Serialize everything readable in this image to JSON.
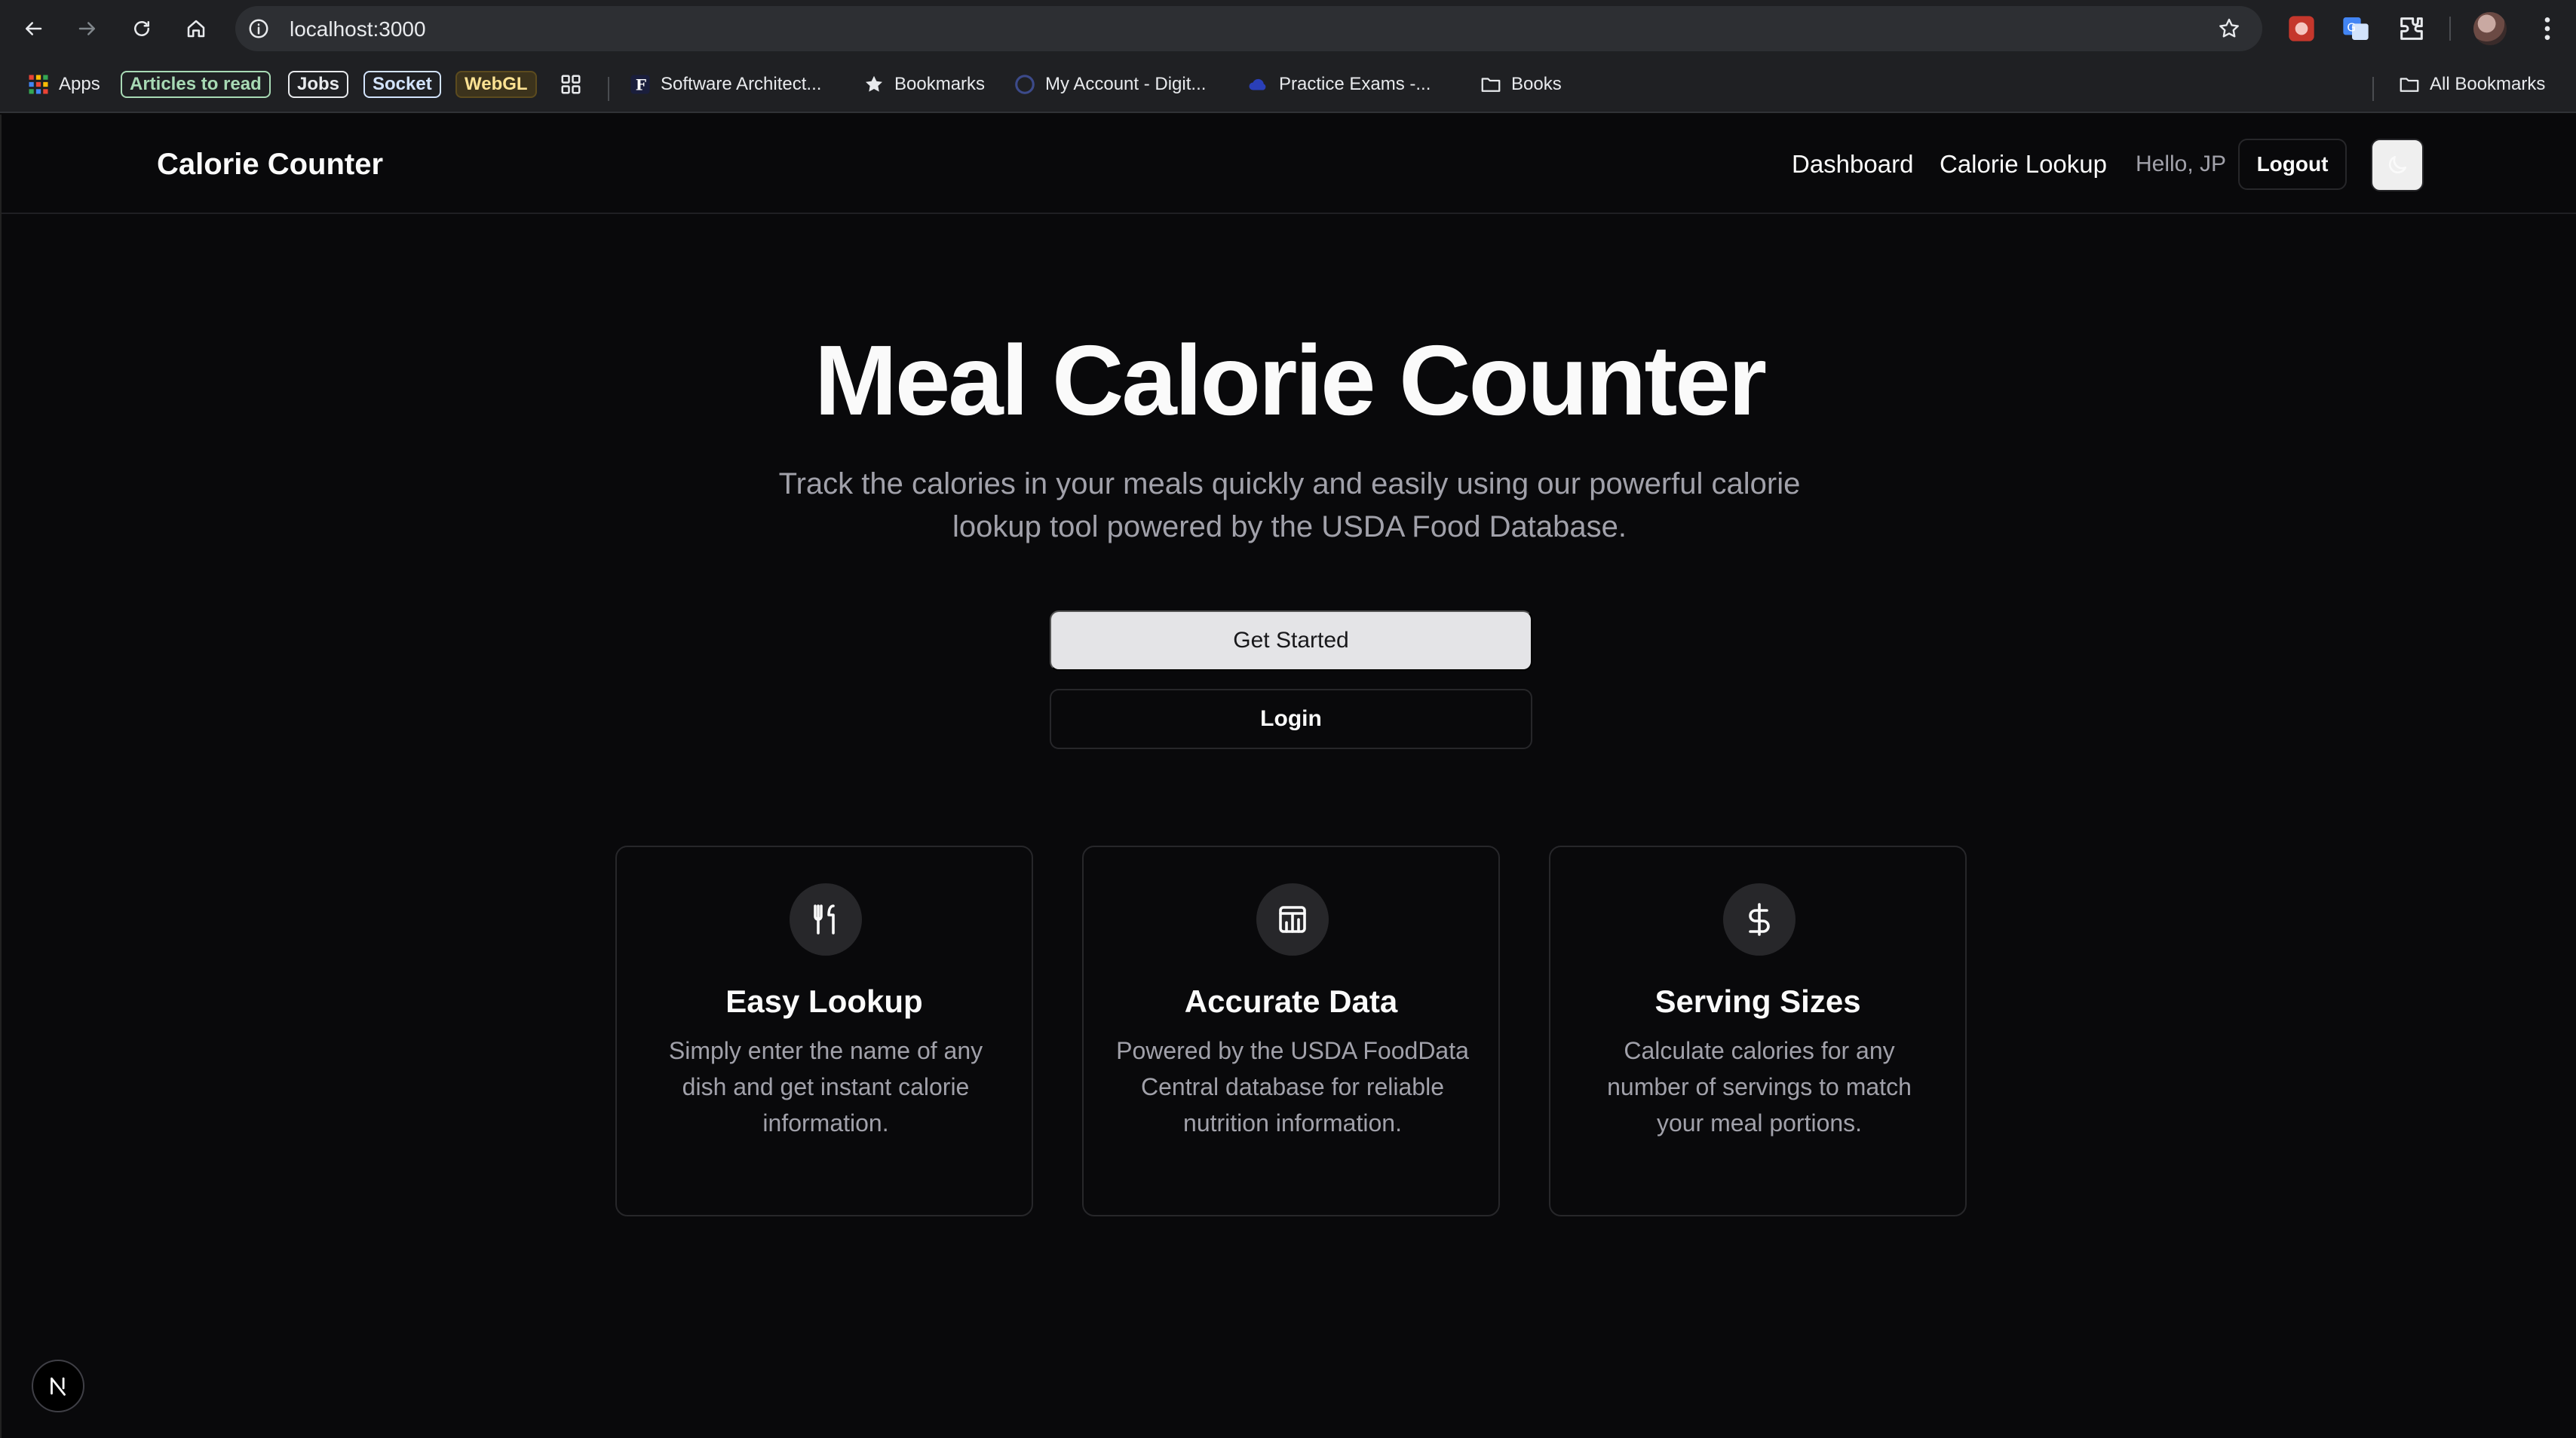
{
  "browser": {
    "url": "localhost:3000",
    "bookmarks": [
      {
        "label": "Apps"
      },
      {
        "label": "Articles to read",
        "color": "#a8dab5"
      },
      {
        "label": "Jobs",
        "color": "#e8eaed"
      },
      {
        "label": "Socket",
        "color": "#d2e3fc"
      },
      {
        "label": "WebGL",
        "color": "#fde293"
      },
      {
        "label": "Software Architect..."
      },
      {
        "label": "Bookmarks"
      },
      {
        "label": "My Account - Digit..."
      },
      {
        "label": "Practice Exams -..."
      },
      {
        "label": "Books"
      },
      {
        "label": "All Bookmarks"
      }
    ]
  },
  "app": {
    "brand": "Calorie Counter",
    "nav": {
      "dashboard": "Dashboard",
      "lookup": "Calorie Lookup",
      "greeting": "Hello, JP",
      "logout": "Logout"
    },
    "hero": {
      "title": "Meal Calorie Counter",
      "subtitle": "Track the calories in your meals quickly and easily using our powerful calorie lookup tool powered by the USDA Food Database.",
      "primary_cta": "Get Started",
      "secondary_cta": "Login"
    },
    "features": [
      {
        "icon": "utensils-icon",
        "title": "Easy Lookup",
        "desc": "Simply enter the name of any dish and get instant calorie information."
      },
      {
        "icon": "database-icon",
        "title": "Accurate Data",
        "desc": "Powered by the USDA FoodData Central database for reliable nutrition information."
      },
      {
        "icon": "dollar-icon",
        "title": "Serving Sizes",
        "desc": "Calculate calories for any number of servings to match your meal portions."
      }
    ]
  },
  "colors": {
    "background": "#09090b",
    "muted_text": "#a1a1aa",
    "border": "#27272a",
    "primary_button": "#e4e4e7"
  }
}
